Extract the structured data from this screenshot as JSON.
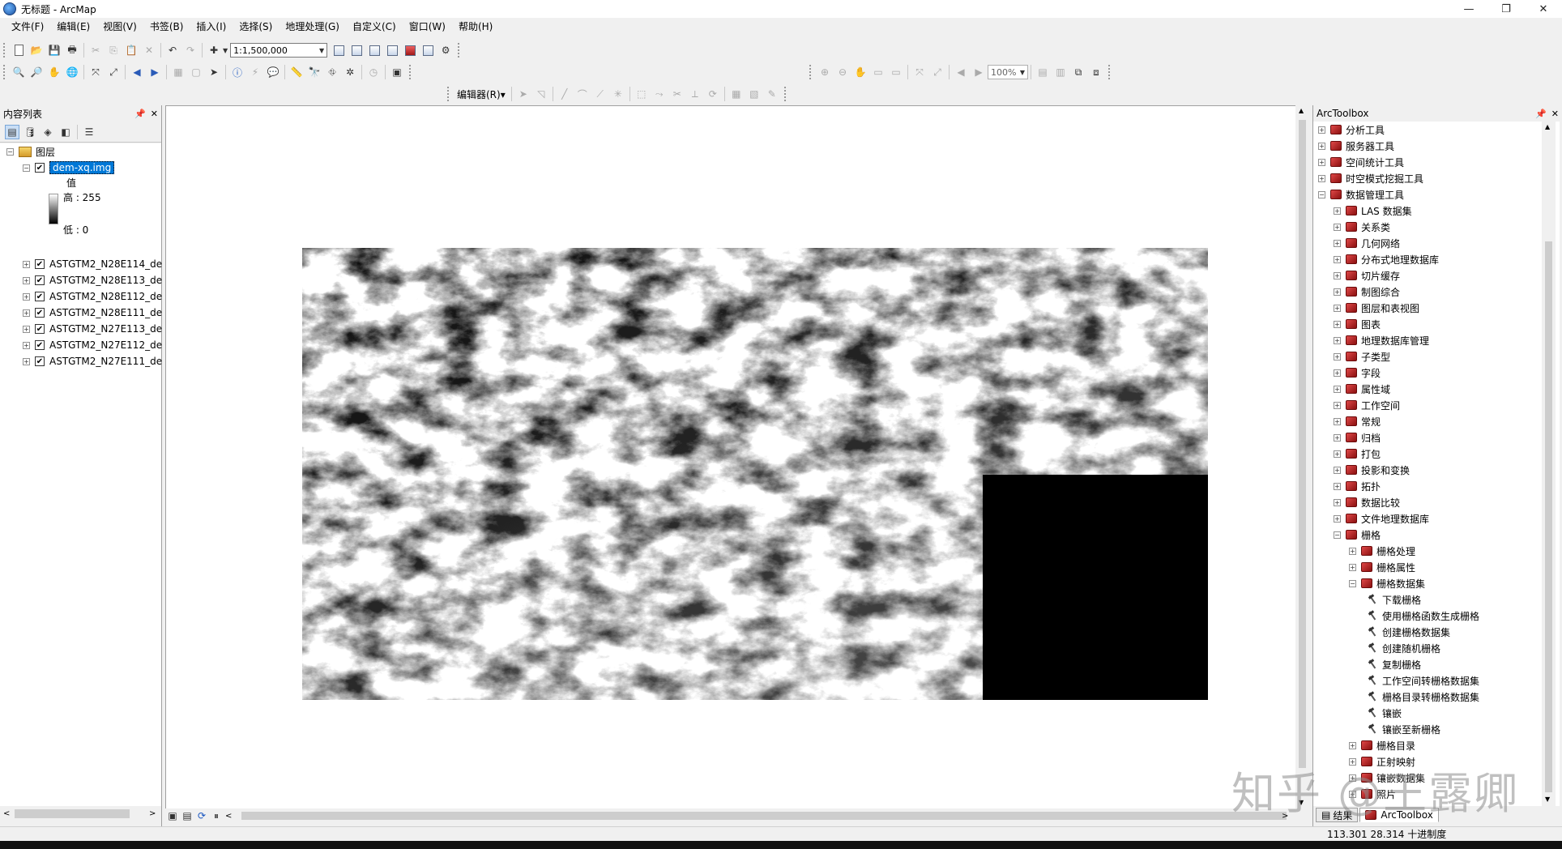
{
  "window": {
    "title": "无标题 - ArcMap",
    "minimize": "—",
    "restore": "❐",
    "close": "✕"
  },
  "menu": [
    "文件(F)",
    "编辑(E)",
    "视图(V)",
    "书签(B)",
    "插入(I)",
    "选择(S)",
    "地理处理(G)",
    "自定义(C)",
    "窗口(W)",
    "帮助(H)"
  ],
  "toolbar": {
    "scale": "1:1,500,000",
    "zoom_percent": "100%",
    "editor_label": "编辑器(R)▾"
  },
  "toc": {
    "title": "内容列表",
    "root_label": "图层",
    "selected_layer": "dem-xq.img",
    "legend_value_label": "值",
    "legend_high": "高 : 255",
    "legend_low": "低 : 0",
    "layers": [
      "ASTGTM2_N28E114_de",
      "ASTGTM2_N28E113_de",
      "ASTGTM2_N28E112_de",
      "ASTGTM2_N28E111_de",
      "ASTGTM2_N27E113_de",
      "ASTGTM2_N27E112_de",
      "ASTGTM2_N27E111_de"
    ]
  },
  "toolbox": {
    "title": "ArcToolbox",
    "top_items": [
      "分析工具",
      "服务器工具",
      "空间统计工具",
      "时空模式挖掘工具",
      "数据管理工具"
    ],
    "data_mgmt_children": [
      "LAS 数据集",
      "关系类",
      "几何网络",
      "分布式地理数据库",
      "切片缓存",
      "制图综合",
      "图层和表视图",
      "图表",
      "地理数据库管理",
      "子类型",
      "字段",
      "属性域",
      "工作空间",
      "常规",
      "归档",
      "打包",
      "投影和变换",
      "拓扑",
      "数据比较",
      "文件地理数据库",
      "栅格"
    ],
    "raster_children": [
      "栅格处理",
      "栅格属性",
      "栅格数据集"
    ],
    "raster_dataset_tools": [
      "下载栅格",
      "使用栅格函数生成栅格",
      "创建栅格数据集",
      "创建随机栅格",
      "复制栅格",
      "工作空间转栅格数据集",
      "栅格目录转栅格数据集",
      "镶嵌",
      "镶嵌至新栅格"
    ],
    "after_items": [
      "栅格目录",
      "正射映射",
      "镶嵌数据集",
      "照片"
    ],
    "tab_results": "结果",
    "tab_toolbox": "ArcToolbox"
  },
  "status": {
    "coords": "113.301   28.314 十进制度"
  },
  "watermark": "知乎 @王露卿"
}
